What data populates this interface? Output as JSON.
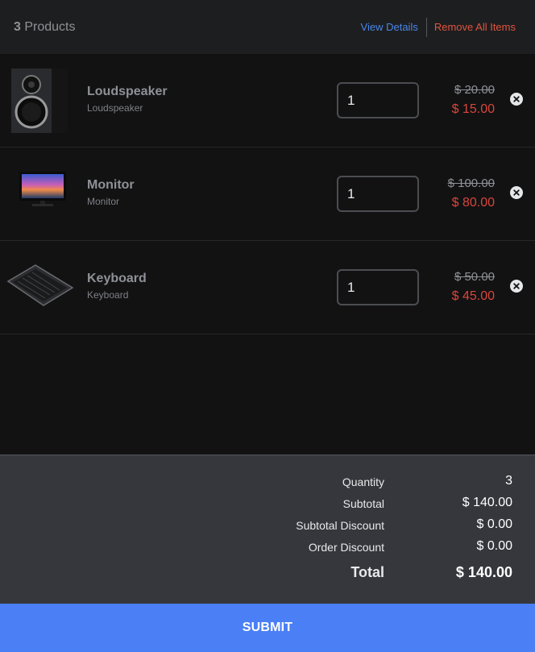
{
  "header": {
    "product_count": "3",
    "product_count_label": "Products",
    "view_details": "View Details",
    "remove_all": "Remove All Items"
  },
  "items": [
    {
      "name": "Loudspeaker",
      "subtitle": "Loudspeaker",
      "quantity": "1",
      "old_price": "$ 20.00",
      "new_price": "$ 15.00",
      "image": "loudspeaker-image"
    },
    {
      "name": "Monitor",
      "subtitle": "Monitor",
      "quantity": "1",
      "old_price": "$ 100.00",
      "new_price": "$ 80.00",
      "image": "monitor-image"
    },
    {
      "name": "Keyboard",
      "subtitle": "Keyboard",
      "quantity": "1",
      "old_price": "$ 50.00",
      "new_price": "$ 45.00",
      "image": "keyboard-image"
    }
  ],
  "summary": {
    "quantity_label": "Quantity",
    "quantity_value": "3",
    "subtotal_label": "Subtotal",
    "subtotal_value": "$ 140.00",
    "subtotal_discount_label": "Subtotal Discount",
    "subtotal_discount_value": "$ 0.00",
    "order_discount_label": "Order Discount",
    "order_discount_value": "$ 0.00",
    "total_label": "Total",
    "total_value": "$ 140.00"
  },
  "submit_label": "SUBMIT",
  "colors": {
    "background": "#121213",
    "header": "#1d1e20",
    "summary": "#35373c",
    "accent": "#4a7ff6",
    "link": "#4a86e8",
    "danger": "#e0543e",
    "sale_price": "#d9463b"
  }
}
